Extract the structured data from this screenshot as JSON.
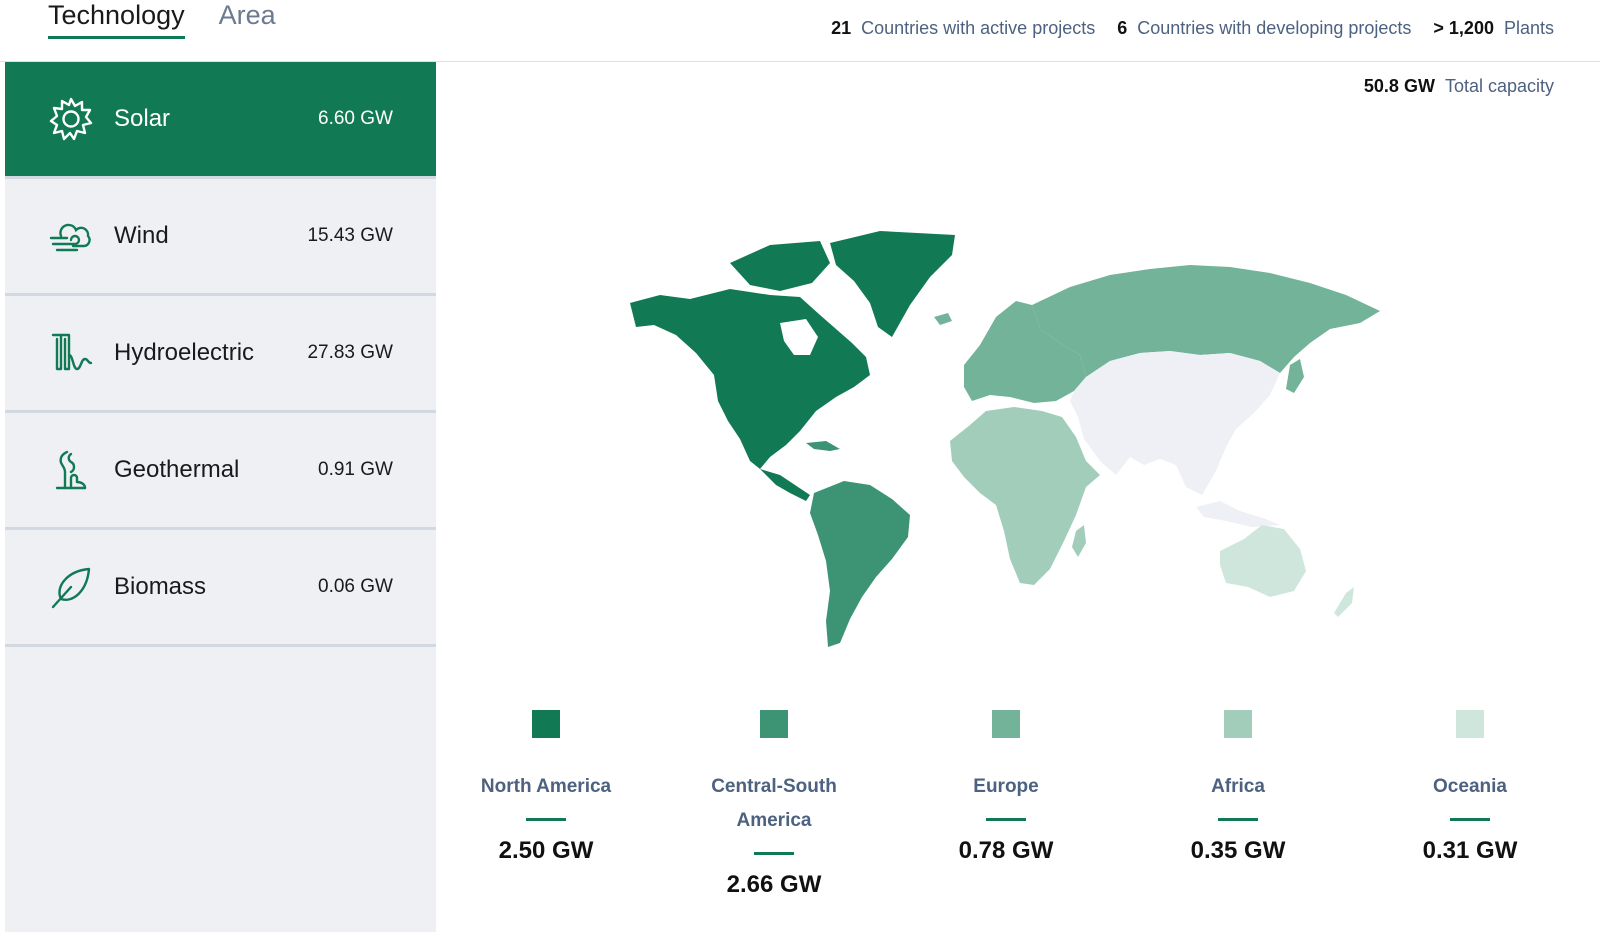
{
  "tabs": [
    {
      "label": "Technology"
    },
    {
      "label": "Area"
    }
  ],
  "stats": {
    "active_countries": {
      "value": "21",
      "label": "Countries with active projects"
    },
    "developing_countries": {
      "value": "6",
      "label": "Countries with developing projects"
    },
    "plants": {
      "value": "> 1,200",
      "label": "Plants"
    }
  },
  "capacity": {
    "value": "50.8 GW",
    "label": "Total capacity"
  },
  "technologies": [
    {
      "name": "Solar",
      "value": "6.60 GW",
      "icon": "sun-icon",
      "selected": true
    },
    {
      "name": "Wind",
      "value": "15.43 GW",
      "icon": "wind-icon",
      "selected": false
    },
    {
      "name": "Hydroelectric",
      "value": "27.83 GW",
      "icon": "hydro-icon",
      "selected": false
    },
    {
      "name": "Geothermal",
      "value": "0.91 GW",
      "icon": "geothermal-icon",
      "selected": false
    },
    {
      "name": "Biomass",
      "value": "0.06 GW",
      "icon": "leaf-icon",
      "selected": false
    }
  ],
  "regions": [
    {
      "name": "North America",
      "value": "2.50 GW",
      "color": "#117a55"
    },
    {
      "name": "Central-South America",
      "value": "2.66 GW",
      "color": "#3d9474"
    },
    {
      "name": "Europe",
      "value": "0.78 GW",
      "color": "#72b39a"
    },
    {
      "name": "Africa",
      "value": "0.35 GW",
      "color": "#a2cdbb"
    },
    {
      "name": "Oceania",
      "value": "0.31 GW",
      "color": "#cfe6dc"
    }
  ],
  "colors": {
    "accent": "#117a55",
    "asia_no_data": "#eef0f5",
    "sidebar_bg": "#eef0f4"
  }
}
